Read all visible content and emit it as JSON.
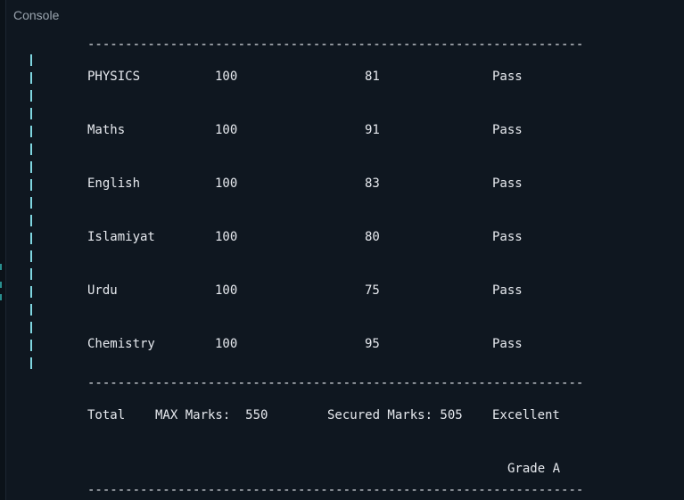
{
  "panel": {
    "title": "Console"
  },
  "output": {
    "separator": "------------------------------------------------------------------",
    "rows": [
      {
        "subject": "PHYSICS",
        "max": "100",
        "marks": "81",
        "status": "Pass"
      },
      {
        "subject": "Maths",
        "max": "100",
        "marks": "91",
        "status": "Pass"
      },
      {
        "subject": "English",
        "max": "100",
        "marks": "83",
        "status": "Pass"
      },
      {
        "subject": "Islamiyat",
        "max": "100",
        "marks": "80",
        "status": "Pass"
      },
      {
        "subject": "Urdu",
        "max": "100",
        "marks": "75",
        "status": "Pass"
      },
      {
        "subject": "Chemistry",
        "max": "100",
        "marks": "95",
        "status": "Pass"
      }
    ],
    "total": {
      "label": "Total",
      "max_label": "MAX Marks:  550",
      "secured_label": "Secured Marks: 505",
      "remark": "Excellent"
    },
    "grade": "Grade A"
  },
  "colors": {
    "background": "#0f1720",
    "text": "#e6e9ee",
    "pipe": "#7fd6e0",
    "title": "#9aa4ae"
  }
}
